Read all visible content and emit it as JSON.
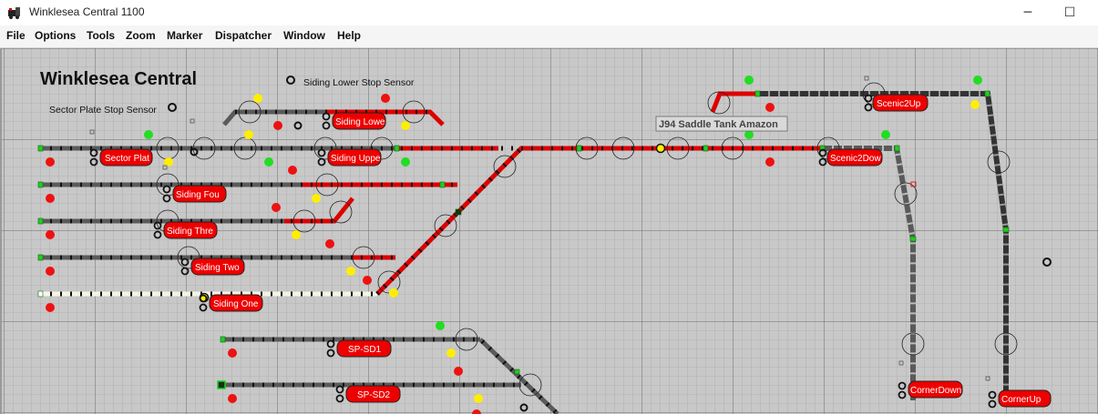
{
  "window": {
    "title": "Winklesea Central 1100",
    "minimize_glyph": "─",
    "maximize_glyph": "☐"
  },
  "menu": [
    {
      "label": "File"
    },
    {
      "label": "Options"
    },
    {
      "label": "Tools"
    },
    {
      "label": "Zoom"
    },
    {
      "label": "Marker"
    },
    {
      "label": "Dispatcher"
    },
    {
      "label": "Window"
    },
    {
      "label": "Help"
    }
  ],
  "panel": {
    "title": "Winklesea Central",
    "labels": {
      "sector_plate_stop_sensor": "Sector Plate Stop Sensor",
      "siding_lower_stop_sensor": "Siding Lower Stop Sensor",
      "train": "J94 Saddle Tank Amazon"
    },
    "blocks": {
      "sector_plat": "Sector Plat",
      "siding_lower": "Siding Lowe",
      "siding_upper": "Siding Uppe",
      "siding_four": "Siding Fou",
      "siding_three": "Siding Thre",
      "siding_two": "Siding Two",
      "siding_one": "Siding One",
      "sp_sd1": "SP-SD1",
      "sp_sd2": "SP-SD2",
      "scenic2up": "Scenic2Up",
      "scenic2down": "Scenic2Dow",
      "cornerdown": "CornerDown",
      "cornerup": "CornerUp"
    }
  },
  "colors": {
    "track_occupied": "#dd0000",
    "track_free": "#555555",
    "track_dark": "#333333",
    "track_allocated": "#f5f5e6",
    "signal_green": "#22dd22",
    "signal_yellow": "#ffee00",
    "signal_red": "#ee1111",
    "block_label_bg": "#ee0000",
    "grid_minor": "#9e9e9e",
    "grid_major": "#7d7d7d",
    "panel_bg": "#c8c8c8"
  }
}
